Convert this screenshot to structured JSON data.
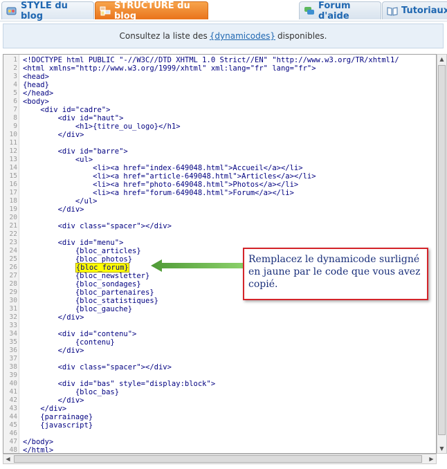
{
  "tabs": [
    {
      "label": "STYLE du blog",
      "icon": "style-icon"
    },
    {
      "label": "STRUCTURE du blog",
      "icon": "structure-icon",
      "active": true
    },
    {
      "label": "Forum d'aide",
      "icon": "forum-icon"
    },
    {
      "label": "Tutoriaux",
      "icon": "book-icon"
    }
  ],
  "info": {
    "before": "Consultez la liste des",
    "link": "{dynamicodes}",
    "after": "disponibles."
  },
  "code_lines": [
    {
      "n": "1",
      "t": "<!DOCTYPE html PUBLIC \"-//W3C//DTD XHTML 1.0 Strict//EN\" \"http://www.w3.org/TR/xhtml1/"
    },
    {
      "n": "2",
      "t": "<html xmlns=\"http://www.w3.org/1999/xhtml\" xml:lang=\"fr\" lang=\"fr\">"
    },
    {
      "n": "3",
      "t": "<head>"
    },
    {
      "n": "4",
      "t": "{head}"
    },
    {
      "n": "5",
      "t": "</head>"
    },
    {
      "n": "6",
      "t": "<body>"
    },
    {
      "n": "7",
      "t": "    <div id=\"cadre\">"
    },
    {
      "n": "8",
      "t": "        <div id=\"haut\">"
    },
    {
      "n": "9",
      "t": "            <h1>{titre_ou_logo}</h1>"
    },
    {
      "n": "10",
      "t": "        </div>"
    },
    {
      "n": "11",
      "t": ""
    },
    {
      "n": "12",
      "t": "        <div id=\"barre\">"
    },
    {
      "n": "13",
      "t": "            <ul>"
    },
    {
      "n": "14",
      "t": "                <li><a href=\"index-649048.html\">Accueil</a></li>"
    },
    {
      "n": "15",
      "t": "                <li><a href=\"article-649048.html\">Articles</a></li>"
    },
    {
      "n": "16",
      "t": "                <li><a href=\"photo-649048.html\">Photos</a></li>"
    },
    {
      "n": "17",
      "t": "                <li><a href=\"forum-649048.html\">Forum</a></li>"
    },
    {
      "n": "18",
      "t": "            </ul>"
    },
    {
      "n": "19",
      "t": "        </div>"
    },
    {
      "n": "20",
      "t": ""
    },
    {
      "n": "21",
      "t": "        <div class=\"spacer\"></div>"
    },
    {
      "n": "22",
      "t": ""
    },
    {
      "n": "23",
      "t": "        <div id=\"menu\">"
    },
    {
      "n": "24",
      "t": "            {bloc_articles}"
    },
    {
      "n": "25",
      "t": "            {bloc_photos}"
    },
    {
      "n": "26",
      "t": "            {bloc_forum}",
      "highlight": true
    },
    {
      "n": "27",
      "t": "            {bloc_newsletter}"
    },
    {
      "n": "28",
      "t": "            {bloc_sondages}"
    },
    {
      "n": "29",
      "t": "            {bloc_partenaires}"
    },
    {
      "n": "30",
      "t": "            {bloc_statistiques}"
    },
    {
      "n": "31",
      "t": "            {bloc_gauche}"
    },
    {
      "n": "32",
      "t": "        </div>"
    },
    {
      "n": "33",
      "t": ""
    },
    {
      "n": "34",
      "t": "        <div id=\"contenu\">"
    },
    {
      "n": "35",
      "t": "            {contenu}"
    },
    {
      "n": "36",
      "t": "        </div>"
    },
    {
      "n": "37",
      "t": ""
    },
    {
      "n": "38",
      "t": "        <div class=\"spacer\"></div>"
    },
    {
      "n": "39",
      "t": ""
    },
    {
      "n": "40",
      "t": "        <div id=\"bas\" style=\"display:block\">"
    },
    {
      "n": "41",
      "t": "            {bloc_bas}"
    },
    {
      "n": "42",
      "t": "        </div>"
    },
    {
      "n": "43",
      "t": "    </div>"
    },
    {
      "n": "44",
      "t": "    {parrainage}"
    },
    {
      "n": "45",
      "t": "    {javascript}"
    },
    {
      "n": "46",
      "t": ""
    },
    {
      "n": "47",
      "t": "</body>"
    },
    {
      "n": "48",
      "t": "</html>"
    }
  ],
  "callout": {
    "text": "Remplacez le dynamicode surligné en jaune par le code que vous avez copié."
  },
  "colors": {
    "accent": "#e9731b",
    "link": "#1f67b1",
    "highlight": "#ffff00",
    "callout_border": "#d4242a",
    "arrow": "#6ab04c"
  }
}
